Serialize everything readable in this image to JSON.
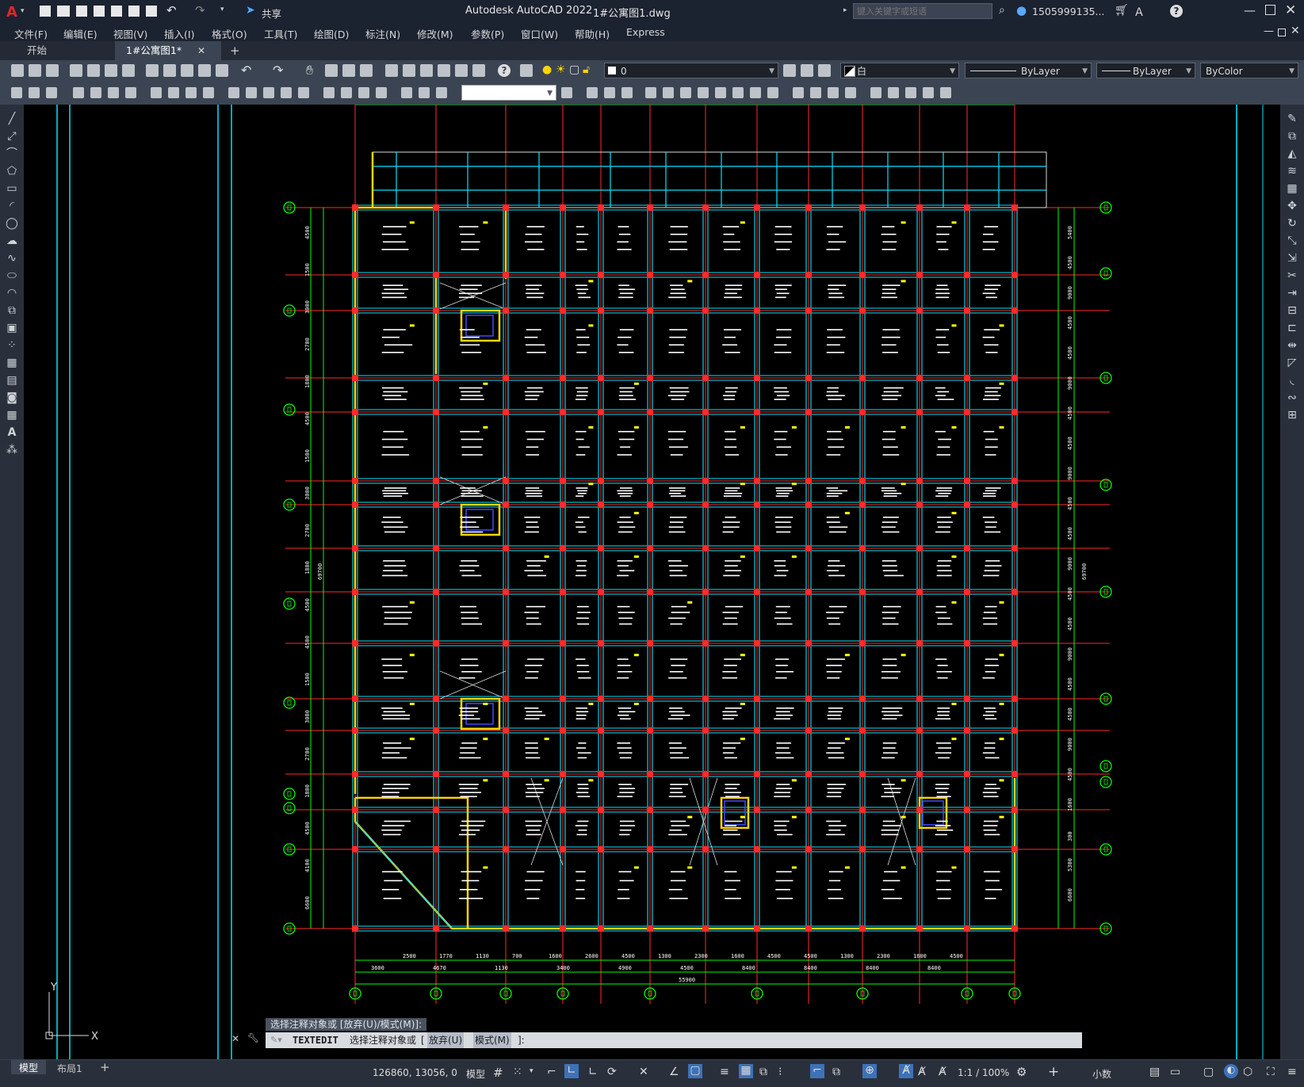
{
  "titlebar": {
    "app_title": "Autodesk AutoCAD 2022",
    "file_name": "1#公寓图1.dwg",
    "share_label": "共享",
    "search_placeholder": "键入关键字或短语",
    "user_label": "1505999135...",
    "help_label": "?"
  },
  "menu": {
    "items": [
      "文件(F)",
      "编辑(E)",
      "视图(V)",
      "插入(I)",
      "格式(O)",
      "工具(T)",
      "绘图(D)",
      "标注(N)",
      "修改(M)",
      "参数(P)",
      "窗口(W)",
      "帮助(H)",
      "Express"
    ]
  },
  "tabs": {
    "start_label": "开始",
    "active_label": "1#公寓图1*",
    "add_label": "+"
  },
  "properties": {
    "layer_value": "0",
    "color_value": "白",
    "linetype_value": "ByLayer",
    "lineweight_value": "ByLayer",
    "plotstyle_value": "ByColor"
  },
  "ucs": {
    "y_label": "Y",
    "x_label": "X"
  },
  "command": {
    "history_line": "选择注释对象或 [放弃(U)/模式(M)]:",
    "prompt_command": "TEXTEDIT",
    "prompt_text": "选择注释对象或",
    "prompt_opt1": "放弃(U)",
    "prompt_opt2": "模式(M)",
    "prompt_end": "]:"
  },
  "status": {
    "tab_model": "模型",
    "tab_layout": "布局1",
    "add_layout": "+",
    "coordinates": "126860, 13056, 0",
    "space_label": "模型",
    "scale_label": "1:1 / 100%",
    "units_label": "小数"
  },
  "dimensions": {
    "bottom_row1": [
      "2500",
      "1770",
      "1130",
      "700",
      "1600",
      "2600",
      "4500",
      "1300",
      "2300",
      "1600",
      "4500",
      "4500",
      "1300",
      "2300",
      "1600",
      "4500"
    ],
    "bottom_row2": [
      "3600",
      "4670",
      "1130",
      "3400",
      "4900",
      "4500",
      "8400",
      "8400",
      "8400",
      "8400"
    ],
    "bottom_total": "55900",
    "left_dims": [
      "4500",
      "1500",
      "3000",
      "2700",
      "1800",
      "4500",
      "1500",
      "3000",
      "2700",
      "1800",
      "4500",
      "4500",
      "1500",
      "3000",
      "2700",
      "1800",
      "4500",
      "4100",
      "6600"
    ],
    "left_total": "69700",
    "right_dims": [
      "5400",
      "4500",
      "9000",
      "4500",
      "4500",
      "9000",
      "4500",
      "4500",
      "9000",
      "4500",
      "4500",
      "9000",
      "4500",
      "4500",
      "9000",
      "4500",
      "4500",
      "9000",
      "4500",
      "1600",
      "300",
      "5300",
      "6600"
    ],
    "right_total": "69700"
  },
  "colors": {
    "grid_axis": "#ff2a2a",
    "beam": "#00e5ff",
    "wall": "#ffd400",
    "column": "#ff2a2a",
    "dimension": "#00ff00",
    "annotation": "#ffffff",
    "highlight": "#ffff00"
  }
}
